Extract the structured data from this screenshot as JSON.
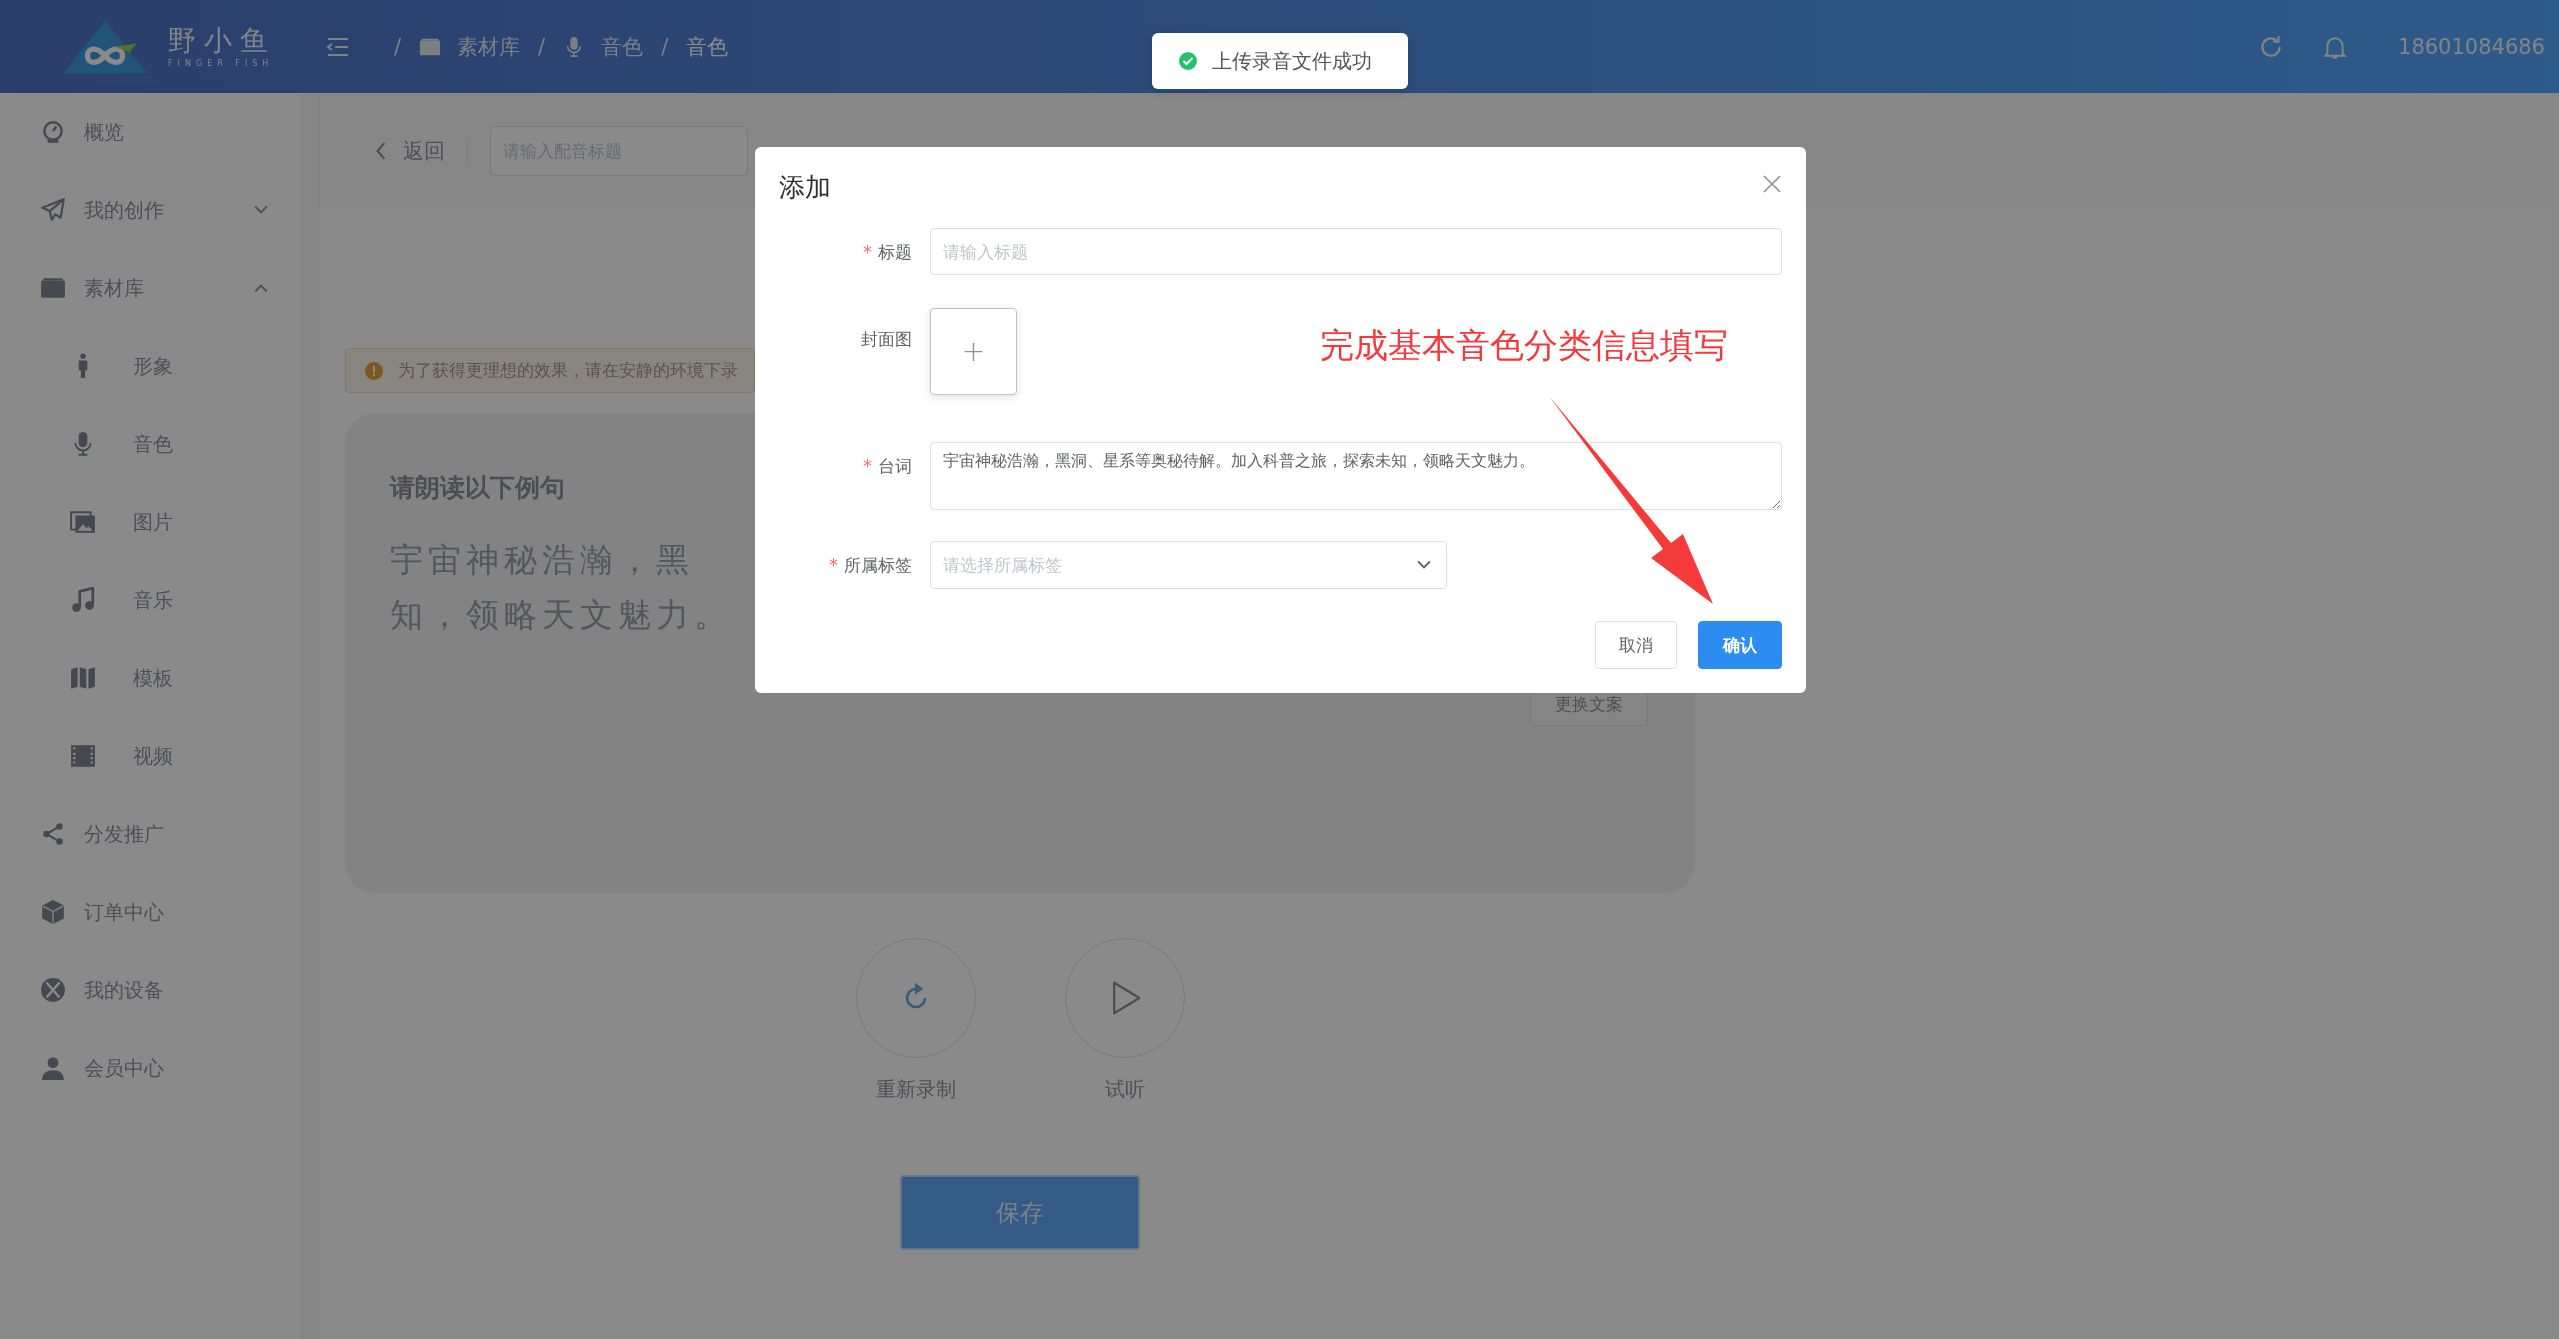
{
  "header": {
    "logo": {
      "name": "野小鱼",
      "subtitle": "FINGER FISH"
    },
    "breadcrumb": {
      "separator": "/",
      "items": [
        {
          "label": "素材库"
        },
        {
          "label": "音色"
        },
        {
          "label": "音色"
        }
      ]
    },
    "user": "18601084686"
  },
  "toast": {
    "kind": "success",
    "text": "上传录音文件成功"
  },
  "sidebar": {
    "items": [
      {
        "label": "概览"
      },
      {
        "label": "我的创作",
        "expanded": false
      },
      {
        "label": "素材库",
        "expanded": true,
        "children": [
          {
            "label": "形象"
          },
          {
            "label": "音色"
          },
          {
            "label": "图片"
          },
          {
            "label": "音乐"
          },
          {
            "label": "模板"
          },
          {
            "label": "视频"
          }
        ]
      },
      {
        "label": "分发推广"
      },
      {
        "label": "订单中心"
      },
      {
        "label": "我的设备"
      },
      {
        "label": "会员中心"
      }
    ]
  },
  "page": {
    "back_label": "返回",
    "title_placeholder": "请输入配音标题",
    "alert": "为了获得更理想的效果，请在安静的环境下录",
    "card": {
      "heading": "请朗读以下例句",
      "sentence_lines": [
        "宇宙神秘浩瀚，黑",
        "知，领略天文魅力。"
      ],
      "change_button": "更换文案"
    },
    "actions": [
      {
        "label": "重新录制"
      },
      {
        "label": "试听"
      }
    ],
    "save_button": "保存"
  },
  "dialog": {
    "title": "添加",
    "required_mark": "*",
    "fields": [
      {
        "kind": "input",
        "label": "标题",
        "required": true,
        "placeholder": "请输入标题"
      },
      {
        "kind": "upload",
        "label": "封面图",
        "required": false,
        "button": "+"
      },
      {
        "kind": "textarea",
        "label": "台词",
        "required": true,
        "value": "宇宙神秘浩瀚，黑洞、星系等奥秘待解。加入科普之旅，探索未知，领略天文魅力。"
      },
      {
        "kind": "select",
        "label": "所属标签",
        "required": true,
        "placeholder": "请选择所属标签"
      }
    ],
    "annotation": "完成基本音色分类信息填写",
    "buttons": [
      {
        "label": "取消",
        "primary": false
      },
      {
        "label": "确认",
        "primary": true
      }
    ]
  }
}
